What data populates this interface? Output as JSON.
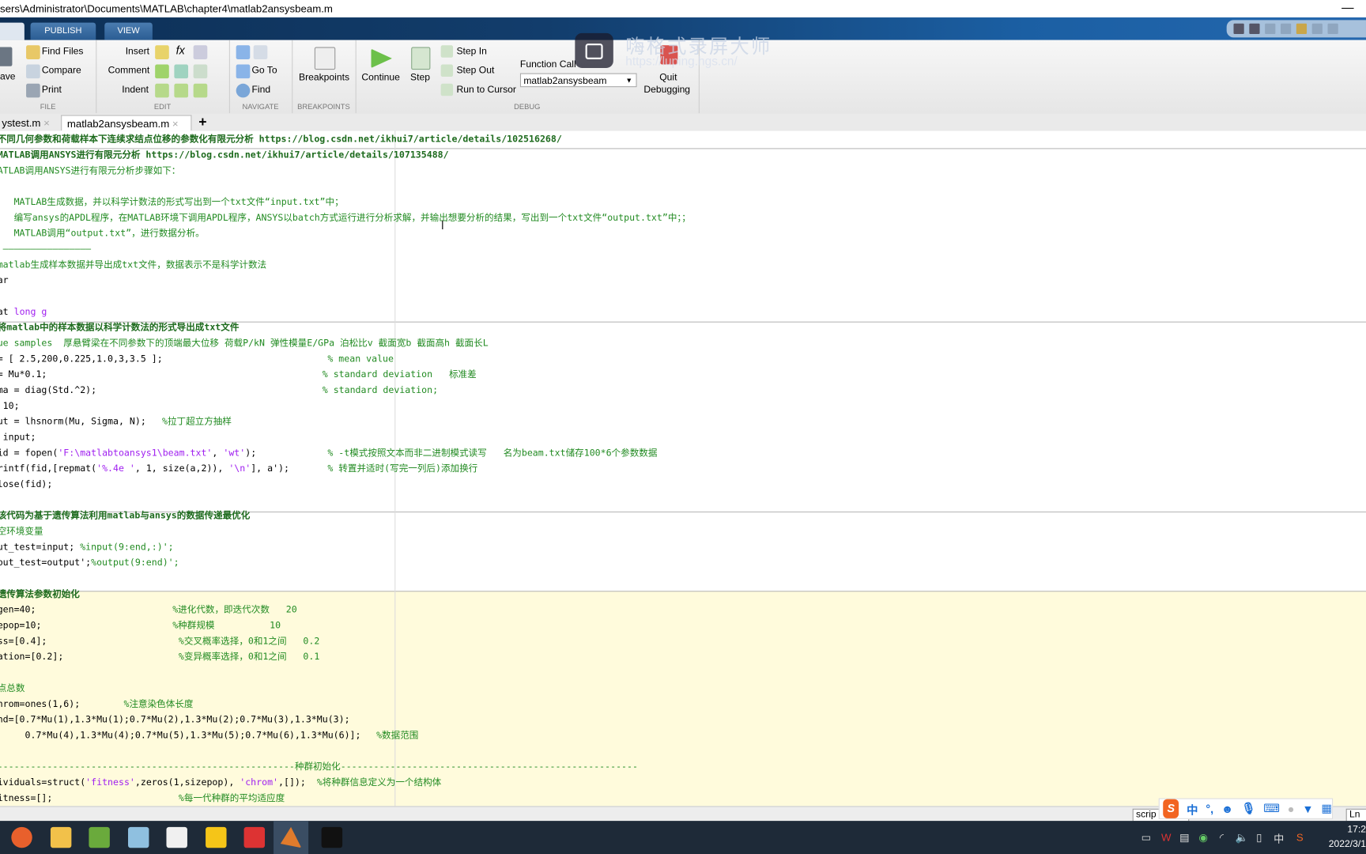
{
  "window": {
    "title_path": "sers\\Administrator\\Documents\\MATLAB\\chapter4\\matlab2ansysbeam.m",
    "minimize": "—"
  },
  "ribbon_tabs": [
    {
      "label": "PUBLISH"
    },
    {
      "label": "VIEW"
    }
  ],
  "ribbon": {
    "file": {
      "section": "FILE",
      "save": "ave",
      "find_files": "Find Files",
      "compare": "Compare",
      "print": "Print"
    },
    "edit": {
      "section": "EDIT",
      "insert": "Insert",
      "comment": "Comment",
      "indent": "Indent",
      "fx": "fx"
    },
    "navigate": {
      "section": "NAVIGATE",
      "goto": "Go To",
      "find": "Find"
    },
    "breakpoints": {
      "section": "BREAKPOINTS",
      "label": "Breakpoints"
    },
    "debug": {
      "section": "DEBUG",
      "continue": "Continue",
      "step": "Step",
      "step_in": "Step In",
      "step_out": "Step Out",
      "run_to_cursor": "Run to Cursor",
      "function_call": "Function Call",
      "function_call_value": "matlab2ansysbeam",
      "quit_1": "Quit",
      "quit_2": "Debugging"
    }
  },
  "file_tabs": [
    {
      "label": "ystest.m",
      "active": false
    },
    {
      "label": "matlab2ansysbeam.m",
      "active": true
    }
  ],
  "add_tab": "+",
  "colors": {
    "comment": "#228b22",
    "string": "#a020f0",
    "cell_highlight": "#fffbdc"
  },
  "code_lines": [
    [
      {
        "t": "不同几何参数和荷载样本下连续求结点位移的参数化有限元分析 https://blog.csdn.net/ikhui7/article/details/102516268/",
        "c": "b"
      }
    ],
    [
      {
        "t": "MATLAB调用ANSYS进行有限元分析 https://blog.csdn.net/ikhui7/article/details/107135488/",
        "c": "b"
      }
    ],
    [
      {
        "t": "ATLAB调用ANSYS进行有限元分析步骤如下：",
        "c": "g"
      }
    ],
    [],
    [
      {
        "t": "   MATLAB生成数据，并以科学计数法的形式写出到一个txt文件“input.txt”中；",
        "c": "g"
      }
    ],
    [
      {
        "t": "   编写ansys的APDL程序，在MATLAB环境下调用APDL程序，ANSYS以batch方式运行进行分析求解，并输出想要分析的结果，写出到一个txt文件“output.txt”中；；",
        "c": "g"
      }
    ],
    [
      {
        "t": "   MATLAB调用“output.txt”，进行数据分析。",
        "c": "g"
      }
    ],
    [
      {
        "t": " ————————————————",
        "c": "g"
      }
    ],
    [
      {
        "t": "matlab生成样本数据并导出成txt文件，数据表示不是科学计数法",
        "c": "g"
      }
    ],
    [
      {
        "t": "ar",
        "c": "k"
      }
    ],
    [],
    [
      {
        "t": "at ",
        "c": "k"
      },
      {
        "t": "long g",
        "c": "p"
      }
    ],
    [
      {
        "t": "将matlab中的样本数据以科学计数法的形式导出成txt文件",
        "c": "b"
      }
    ],
    [
      {
        "t": "ue samples  厚悬臂梁在不同参数下的顶端最大位移 荷载P/kN 弹性模量E/GPa 泊松比v 截面宽b 截面高h 截面长L",
        "c": "g"
      }
    ],
    [
      {
        "t": "= [ 2.5,200,0.225,1.0,3,3.5 ];",
        "c": "k"
      },
      {
        "t": "% mean value",
        "c": "cm"
      }
    ],
    [
      {
        "t": "= Mu*0.1;",
        "c": "k"
      },
      {
        "t": "% standard deviation   标准差",
        "c": "cm"
      }
    ],
    [
      {
        "t": "ma = diag(Std.^2);",
        "c": "k"
      },
      {
        "t": "% standard deviation;",
        "c": "cm"
      }
    ],
    [
      {
        "t": " 10;",
        "c": "k"
      }
    ],
    [
      {
        "t": "ut = lhsnorm(Mu, Sigma, N);",
        "c": "k"
      },
      {
        "t": "%拉丁超立方抽样",
        "c": "cm"
      }
    ],
    [
      {
        "t": " input;",
        "c": "k"
      }
    ],
    [
      {
        "t": "id = fopen(",
        "c": "k"
      },
      {
        "t": "'F:\\matlabtoansys1\\beam.txt'",
        "c": "p"
      },
      {
        "t": ", ",
        "c": "k"
      },
      {
        "t": "'wt'",
        "c": "p"
      },
      {
        "t": ");",
        "c": "k"
      },
      {
        "t": "% -t模式按照文本而非二进制模式读写   名为beam.txt储存100*6个参数数据",
        "c": "cm"
      }
    ],
    [
      {
        "t": "rintf(fid,[repmat(",
        "c": "k"
      },
      {
        "t": "'%.4e '",
        "c": "p"
      },
      {
        "t": ", 1, size(a,2)), ",
        "c": "k"
      },
      {
        "t": "'\\n'",
        "c": "p"
      },
      {
        "t": "], a');",
        "c": "k"
      },
      {
        "t": "% 转置并适时(写完一列后)添加换行",
        "c": "cm"
      }
    ],
    [
      {
        "t": "lose(fid);",
        "c": "k"
      }
    ],
    [],
    [
      {
        "t": "该代码为基于遗传算法利用matlab与ansys的数据传递最优化",
        "c": "b"
      }
    ],
    [
      {
        "t": "空环境变量",
        "c": "g"
      }
    ],
    [
      {
        "t": "ut_test=input; ",
        "c": "k"
      },
      {
        "t": "%input(9:end,:)';",
        "c": "g"
      }
    ],
    [
      {
        "t": "put_test=output';",
        "c": "k"
      },
      {
        "t": "%output(9:end)';",
        "c": "g"
      }
    ],
    [],
    [
      {
        "t": "遗传算法参数初始化",
        "c": "b"
      }
    ],
    [
      {
        "t": "gen=40;",
        "c": "k"
      },
      {
        "t": "%进化代数，即迭代次数   20",
        "c": "cm"
      }
    ],
    [
      {
        "t": "epop=10;",
        "c": "k"
      },
      {
        "t": "%种群规模          10",
        "c": "cm"
      }
    ],
    [
      {
        "t": "ss=[0.4];",
        "c": "k"
      },
      {
        "t": "%交叉概率选择，0和1之间   0.2",
        "c": "cm"
      }
    ],
    [
      {
        "t": "ation=[0.2];",
        "c": "k"
      },
      {
        "t": "%变异概率选择，0和1之间   0.1",
        "c": "cm"
      }
    ],
    [],
    [
      {
        "t": "点总数",
        "c": "g"
      }
    ],
    [
      {
        "t": "hrom=ones(1,6);",
        "c": "k"
      },
      {
        "t": "%注意染色体长度",
        "c": "cm"
      }
    ],
    [
      {
        "t": "nd=[0.7*Mu(1),1.3*Mu(1);0.7*Mu(2),1.3*Mu(2);0.7*Mu(3),1.3*Mu(3);",
        "c": "k"
      }
    ],
    [
      {
        "t": "     0.7*Mu(4),1.3*Mu(4);0.7*Mu(5),1.3*Mu(5);0.7*Mu(6),1.3*Mu(6)];",
        "c": "k"
      },
      {
        "t": "%数据范围",
        "c": "cm"
      }
    ],
    [],
    [
      {
        "t": "------------------------------------------------------种群初始化------------------------------------------------------",
        "c": "g"
      }
    ],
    [
      {
        "t": "ividuals=struct(",
        "c": "k"
      },
      {
        "t": "'fitness'",
        "c": "p"
      },
      {
        "t": ",zeros(1,sizepop), ",
        "c": "k"
      },
      {
        "t": "'chrom'",
        "c": "p"
      },
      {
        "t": ",[]);  ",
        "c": "k"
      },
      {
        "t": "%将种群信息定义为一个结构体",
        "c": "g"
      }
    ],
    [
      {
        "t": "itness=[];",
        "c": "k"
      },
      {
        "t": "%每一代种群的平均适应度",
        "c": "cm"
      }
    ]
  ],
  "status": {
    "mode": "scrip",
    "ln": "Ln"
  },
  "ime": {
    "lang": "中",
    "punct": "°,"
  },
  "taskbar": {
    "apps": [
      "firefox-icon",
      "file-explorer-icon",
      "notepad-icon",
      "notes-icon",
      "app-a-icon",
      "app-a-yellow-icon",
      "wps-icon",
      "matlab-icon",
      "screen-recorder-icon"
    ],
    "tray_lang": "中",
    "time": "17:2",
    "date": "2022/3/1"
  },
  "watermark": {
    "name": "嗨格式录屏大师",
    "url": "https://luping.hgs.cn/"
  }
}
